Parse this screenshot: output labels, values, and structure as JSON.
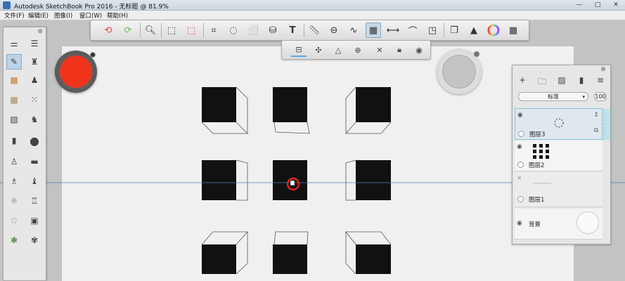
{
  "window": {
    "title": "Autodesk SketchBook Pro 2016 - 无标题 @ 81.9%",
    "controls": {
      "minimize": "—",
      "maximize": "□",
      "close": "✕"
    }
  },
  "menubar": {
    "items": [
      "文件(F)",
      "编辑(E)",
      "图像(I)",
      "窗口(W)",
      "帮助(H)"
    ]
  },
  "toolbar": {
    "tools": [
      "undo-icon",
      "redo-icon",
      "zoom-icon",
      "select-icon",
      "transform-icon",
      "crop-icon",
      "lasso-icon",
      "distort-icon",
      "fill-icon",
      "text-icon",
      "ruler-icon",
      "ellipse-guide-icon",
      "french-curve-icon",
      "perspective-icon",
      "symmetry-icon",
      "stroke-icon",
      "shape-icon",
      "copy-icon",
      "brushes-icon",
      "color-wheel-icon",
      "palette-icon"
    ],
    "colors": {
      "undo": "#e04a2c",
      "redo": "#6fbf5a",
      "accent": "#5fa8e0"
    }
  },
  "perspective_bar": {
    "tools": [
      "one-point-icon",
      "two-point-icon",
      "three-point-icon",
      "vanishing-point-icon",
      "snap-icon",
      "lock-icon",
      "visibility-icon"
    ]
  },
  "color_puck": {
    "color": "#f0341c"
  },
  "layers": {
    "blend_mode": "标准",
    "opacity": "100",
    "items": [
      {
        "name": "图层3",
        "selected": true
      },
      {
        "name": "图层2",
        "selected": false
      },
      {
        "name": "图层1",
        "selected": false
      },
      {
        "name": "背景",
        "selected": false
      }
    ]
  },
  "canvas": {
    "background": "#f0f0f0",
    "square_color": "#111111",
    "horizon_color": "#4a7fb8"
  }
}
